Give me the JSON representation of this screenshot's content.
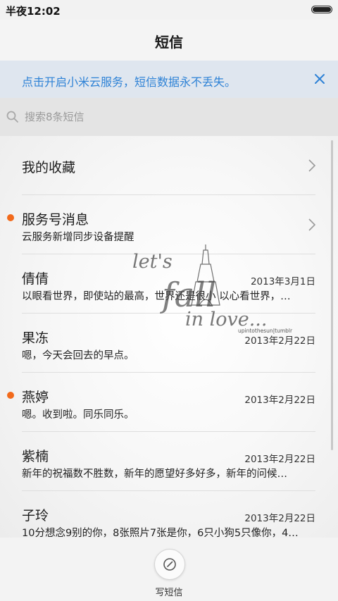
{
  "status_bar": {
    "time": "半夜12:02",
    "battery_level": 1.0
  },
  "header": {
    "title": "短信"
  },
  "notice": {
    "text": "点击开启小米云服务，短信数据永不丢失。",
    "close_icon": "close-icon"
  },
  "search": {
    "placeholder": "搜索8条短信",
    "icon": "search-icon"
  },
  "conversations": [
    {
      "name": "我的收藏",
      "preview": "",
      "date": "",
      "unread": false,
      "chevron": true
    },
    {
      "name": "服务号消息",
      "preview": "云服务新增同步设备提醒",
      "date": "",
      "unread": true,
      "chevron": true
    },
    {
      "name": "倩倩",
      "preview": "以眼看世界，即使站的最高，世界还是很小 以心看世界，…",
      "date": "2013年3月1日",
      "unread": false
    },
    {
      "name": "果冻",
      "preview": "嗯，今天会回去的早点。",
      "date": "2013年2月22日",
      "unread": false
    },
    {
      "name": "燕婷",
      "preview": "嗯。收到啦。同乐同乐。",
      "date": "2013年2月22日",
      "unread": true
    },
    {
      "name": "紫楠",
      "preview": "新年的祝福数不胜数，新年的愿望好多好多，新年的问候…",
      "date": "2013年2月22日",
      "unread": false
    },
    {
      "name": "子玲",
      "preview": "10分想念9别的你，8张照片7张是你，6只小狗5只像你，4…",
      "date": "2013年2月22日",
      "unread": false
    }
  ],
  "wallpaper": {
    "line1": "let's",
    "line2": "fall",
    "line3": "in love...",
    "credit": "upintothesun|tumblr"
  },
  "bottom_bar": {
    "compose_label": "写短信",
    "compose_icon": "compose-icon"
  },
  "colors": {
    "accent": "#2e82d6",
    "unread_dot": "#f26a1b",
    "notice_bg": "#dfe6ef"
  }
}
